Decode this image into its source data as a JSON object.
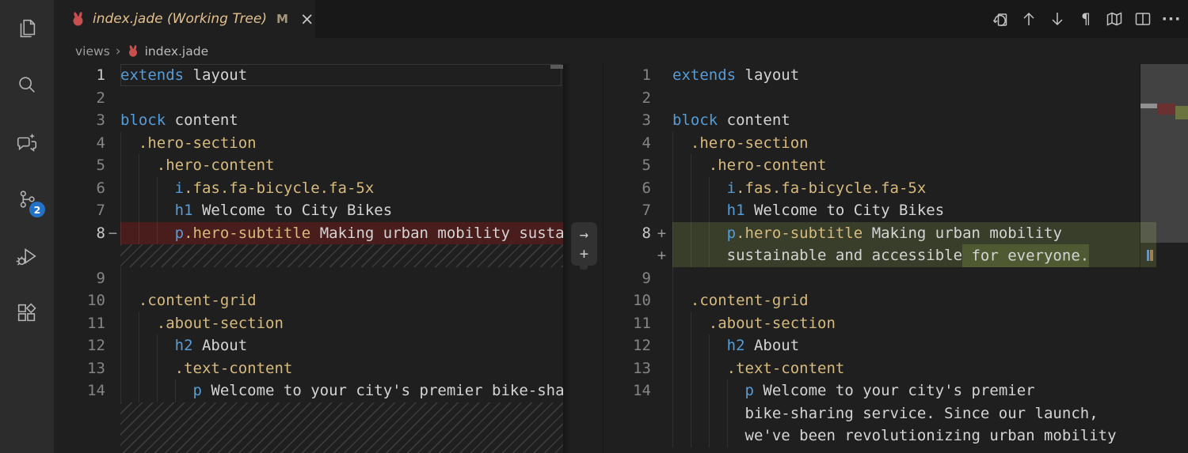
{
  "colors": {
    "editor_bg": "#1f1f1f",
    "tabstrip_bg": "#181818",
    "activitybar_bg": "#2c2c2c",
    "keyword_blue": "#569cd6",
    "class_gold": "#d7ba7d",
    "plain_text": "#d4d4d4",
    "deleted_line_bg": "#4a1d1d",
    "added_line_bg": "#383e2a",
    "added_char_bg": "#4f5a33",
    "git_modified": "#e2c08d",
    "badge_bg": "#2472c8",
    "jade_icon_red": "#c94f4f"
  },
  "activity_bar": {
    "items": [
      "explorer",
      "search",
      "chat",
      "source-control",
      "run-and-debug",
      "extensions"
    ],
    "source_control_badge": "2"
  },
  "tab": {
    "title": "index.jade (Working Tree)",
    "modified_indicator": "M",
    "close_glyph": "×"
  },
  "breadcrumb": {
    "folder": "views",
    "separator": "›",
    "file": "index.jade"
  },
  "toolbar": {
    "icons": [
      "revert-file",
      "previous-change",
      "next-change",
      "toggle-whitespace",
      "map",
      "split-editor",
      "more-actions"
    ],
    "pilcrow_glyph": "¶",
    "more_glyph": "···"
  },
  "diff_widget": {
    "arrow_glyph": "→",
    "plus_glyph": "+"
  },
  "left_editor": {
    "rows": [
      {
        "n": "1",
        "g": 0,
        "hl": true,
        "t": [
          [
            "kw",
            "extends"
          ],
          [
            "pl",
            " layout"
          ]
        ]
      },
      {
        "n": "2",
        "g": 0,
        "t": []
      },
      {
        "n": "3",
        "g": 0,
        "t": [
          [
            "kw",
            "block"
          ],
          [
            "pl",
            " content"
          ]
        ]
      },
      {
        "n": "4",
        "g": 1,
        "t": [
          [
            "pl",
            "  "
          ],
          [
            "cls",
            ".hero-section"
          ]
        ]
      },
      {
        "n": "5",
        "g": 2,
        "t": [
          [
            "pl",
            "    "
          ],
          [
            "cls",
            ".hero-content"
          ]
        ]
      },
      {
        "n": "6",
        "g": 3,
        "t": [
          [
            "pl",
            "      "
          ],
          [
            "kw",
            "i"
          ],
          [
            "cls",
            ".fas.fa-bicycle.fa-5x"
          ]
        ]
      },
      {
        "n": "7",
        "g": 3,
        "t": [
          [
            "pl",
            "      "
          ],
          [
            "kw",
            "h1"
          ],
          [
            "pl",
            " Welcome to City Bikes"
          ]
        ]
      },
      {
        "n": "8",
        "g": 3,
        "hl": true,
        "mark": "−",
        "bg": "del",
        "t": [
          [
            "pl",
            "      "
          ],
          [
            "kw",
            "p"
          ],
          [
            "cls",
            ".hero-subtitle"
          ],
          [
            "pl",
            " Making urban mobility sustaina"
          ]
        ]
      },
      {
        "hatch": true
      },
      {
        "n": "9",
        "g": 1,
        "t": []
      },
      {
        "n": "10",
        "g": 1,
        "t": [
          [
            "pl",
            "  "
          ],
          [
            "cls",
            ".content-grid"
          ]
        ]
      },
      {
        "n": "11",
        "g": 2,
        "t": [
          [
            "pl",
            "    "
          ],
          [
            "cls",
            ".about-section"
          ]
        ]
      },
      {
        "n": "12",
        "g": 3,
        "t": [
          [
            "pl",
            "      "
          ],
          [
            "kw",
            "h2"
          ],
          [
            "pl",
            " About"
          ]
        ]
      },
      {
        "n": "13",
        "g": 3,
        "t": [
          [
            "pl",
            "      "
          ],
          [
            "cls",
            ".text-content"
          ]
        ]
      },
      {
        "n": "14",
        "g": 4,
        "t": [
          [
            "pl",
            "        "
          ],
          [
            "kw",
            "p"
          ],
          [
            "pl",
            " Welcome to your city's premier bike-sha"
          ]
        ]
      },
      {
        "hatch": true,
        "fill": true
      }
    ]
  },
  "right_editor": {
    "rows": [
      {
        "n": "1",
        "g": 0,
        "t": [
          [
            "kw",
            "extends"
          ],
          [
            "pl",
            " layout"
          ]
        ]
      },
      {
        "n": "2",
        "g": 0,
        "t": []
      },
      {
        "n": "3",
        "g": 0,
        "t": [
          [
            "kw",
            "block"
          ],
          [
            "pl",
            " content"
          ]
        ]
      },
      {
        "n": "4",
        "g": 1,
        "t": [
          [
            "pl",
            "  "
          ],
          [
            "cls",
            ".hero-section"
          ]
        ]
      },
      {
        "n": "5",
        "g": 2,
        "t": [
          [
            "pl",
            "    "
          ],
          [
            "cls",
            ".hero-content"
          ]
        ]
      },
      {
        "n": "6",
        "g": 3,
        "t": [
          [
            "pl",
            "      "
          ],
          [
            "kw",
            "i"
          ],
          [
            "cls",
            ".fas.fa-bicycle.fa-5x"
          ]
        ]
      },
      {
        "n": "7",
        "g": 3,
        "t": [
          [
            "pl",
            "      "
          ],
          [
            "kw",
            "h1"
          ],
          [
            "pl",
            " Welcome to City Bikes"
          ]
        ]
      },
      {
        "n": "8",
        "g": 3,
        "hl": true,
        "mark": "+",
        "bg": "add",
        "t": [
          [
            "pl",
            "      "
          ],
          [
            "kw",
            "p"
          ],
          [
            "cls",
            ".hero-subtitle"
          ],
          [
            "pl",
            " Making urban mobility"
          ]
        ]
      },
      {
        "n": "",
        "g": 3,
        "mark": "+",
        "bg": "add",
        "t": [
          [
            "pl",
            "      sustainable and accessible"
          ],
          [
            "ins",
            " for everyone."
          ]
        ]
      },
      {
        "n": "9",
        "g": 1,
        "t": []
      },
      {
        "n": "10",
        "g": 1,
        "t": [
          [
            "pl",
            "  "
          ],
          [
            "cls",
            ".content-grid"
          ]
        ]
      },
      {
        "n": "11",
        "g": 2,
        "t": [
          [
            "pl",
            "    "
          ],
          [
            "cls",
            ".about-section"
          ]
        ]
      },
      {
        "n": "12",
        "g": 3,
        "t": [
          [
            "pl",
            "      "
          ],
          [
            "kw",
            "h2"
          ],
          [
            "pl",
            " About"
          ]
        ]
      },
      {
        "n": "13",
        "g": 3,
        "t": [
          [
            "pl",
            "      "
          ],
          [
            "cls",
            ".text-content"
          ]
        ]
      },
      {
        "n": "14",
        "g": 4,
        "t": [
          [
            "pl",
            "        "
          ],
          [
            "kw",
            "p"
          ],
          [
            "pl",
            " Welcome to your city's premier"
          ]
        ]
      },
      {
        "n": "",
        "g": 4,
        "t": [
          [
            "pl",
            "        bike-sharing service. Since our launch,"
          ]
        ]
      },
      {
        "n": "",
        "g": 4,
        "t": [
          [
            "pl",
            "        we've been revolutionizing urban mobility"
          ]
        ]
      }
    ]
  }
}
